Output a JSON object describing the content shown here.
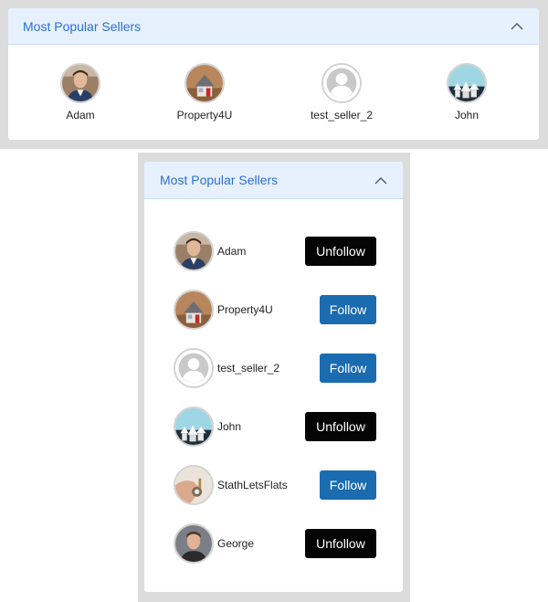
{
  "top_panel": {
    "title": "Most Popular Sellers",
    "sellers": [
      {
        "name": "Adam",
        "avatar": "man-portrait-avatar"
      },
      {
        "name": "Property4U",
        "avatar": "house-photo-avatar"
      },
      {
        "name": "test_seller_2",
        "avatar": "default-user-avatar"
      },
      {
        "name": "John",
        "avatar": "sky-houses-avatar"
      }
    ]
  },
  "side_panel": {
    "title": "Most Popular Sellers",
    "sellers": [
      {
        "name": "Adam",
        "button": "Unfollow",
        "following": true
      },
      {
        "name": "Property4U",
        "button": "Follow",
        "following": false
      },
      {
        "name": "test_seller_2",
        "button": "Follow",
        "following": false
      },
      {
        "name": "John",
        "button": "Unfollow",
        "following": true
      },
      {
        "name": "StathLetsFlats",
        "button": "Follow",
        "following": false
      },
      {
        "name": "George",
        "button": "Unfollow",
        "following": true
      }
    ]
  },
  "colors": {
    "header_bg": "#e7f1fe",
    "header_text": "#2c6fd1",
    "follow_button": "#1a6bb0",
    "unfollow_button": "#050505",
    "frame_gray": "#dcdcdc"
  }
}
